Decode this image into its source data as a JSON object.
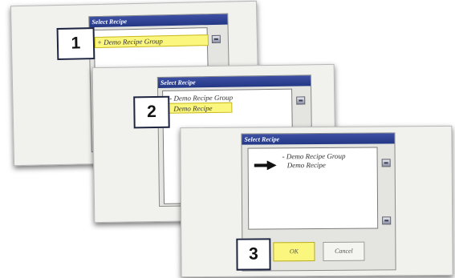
{
  "screens": [
    {
      "callout": "1",
      "dialog_title": "Select Recipe",
      "items": [
        "+ Demo Recipe Group"
      ]
    },
    {
      "callout": "2",
      "dialog_title": "Select Recipe",
      "items": [
        "- Demo Recipe Group",
        "Demo Recipe"
      ]
    },
    {
      "callout": "3",
      "dialog_title": "Select Recipe",
      "items": [
        "- Demo Recipe Group",
        "Demo Recipe"
      ],
      "ok_label": "OK",
      "cancel_label": "Cancel"
    }
  ],
  "colors": {
    "titlebar": "#2f4193",
    "highlight": "#fbf77e",
    "screen": "#f1f1ee"
  },
  "icons": [
    "scroll-up-icon",
    "scroll-down-icon",
    "arrow-right-icon"
  ]
}
